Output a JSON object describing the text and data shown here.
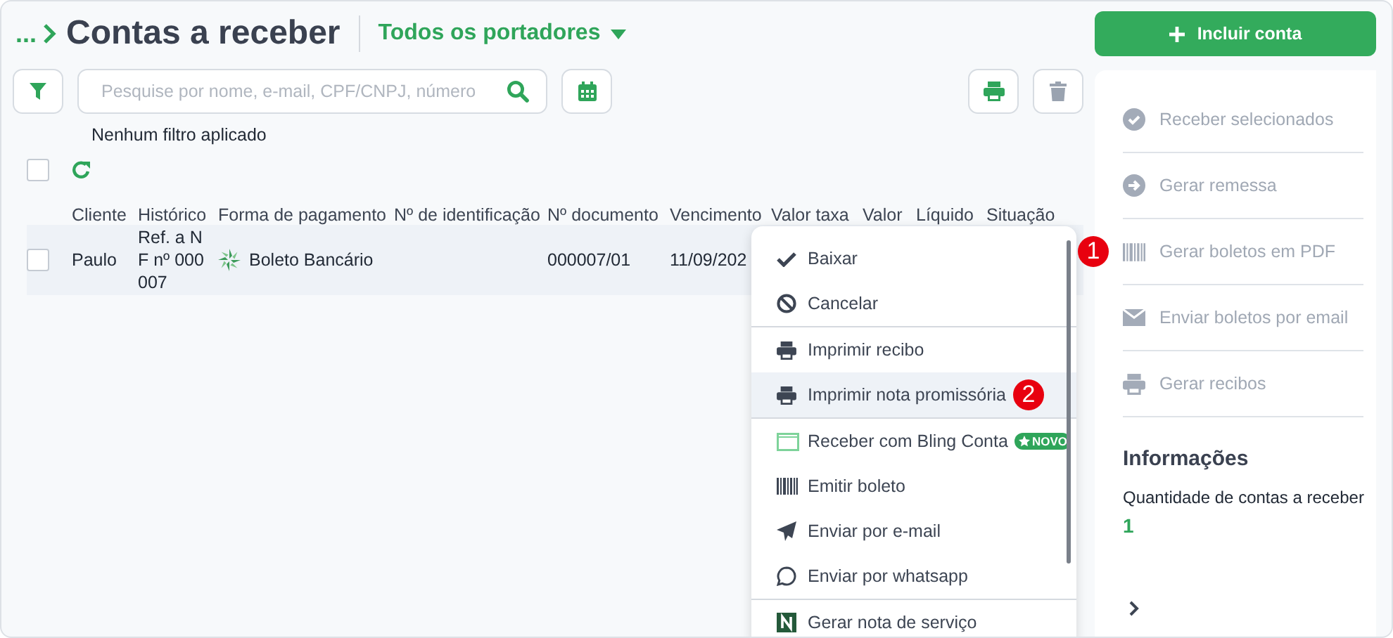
{
  "header": {
    "breadcrumb": "...",
    "title": "Contas a receber",
    "portador": "Todos os portadores"
  },
  "search": {
    "placeholder": "Pesquise por nome, e-mail, CPF/CNPJ, número"
  },
  "filter_status": "Nenhum filtro aplicado",
  "select_all": {
    "checked": false
  },
  "table": {
    "columns": [
      "Cliente",
      "Histórico",
      "Forma de pagamento",
      "Nº de identificação",
      "Nº documento",
      "Vencimento",
      "Valor taxa",
      "Valor",
      "Líquido",
      "Situação"
    ],
    "rows": [
      {
        "checked": false,
        "cliente": "Paulo",
        "historico": "Ref. a N F nº 000 007",
        "forma": "Boleto Bancário",
        "documento": "000007/01",
        "vencimento": "11/09/202"
      }
    ]
  },
  "menu": {
    "items": [
      {
        "label": "Baixar",
        "divider_before": false,
        "highlighted": false
      },
      {
        "label": "Cancelar",
        "divider_before": false,
        "highlighted": false
      },
      {
        "label": "Imprimir recibo",
        "divider_before": true,
        "highlighted": false
      },
      {
        "label": "Imprimir nota promissória",
        "divider_before": false,
        "highlighted": true,
        "marker": "2"
      },
      {
        "label": "Receber com Bling Conta",
        "divider_before": true,
        "highlighted": false,
        "badge": "NOVO"
      },
      {
        "label": "Emitir boleto",
        "divider_before": false,
        "highlighted": false
      },
      {
        "label": "Enviar por e-mail",
        "divider_before": false,
        "highlighted": false
      },
      {
        "label": "Enviar por whatsapp",
        "divider_before": false,
        "highlighted": false
      },
      {
        "label": "Gerar nota de serviço",
        "divider_before": true,
        "highlighted": false
      }
    ]
  },
  "add_button": "Incluir conta",
  "actions": [
    {
      "label": "Receber selecionados",
      "disabled": true
    },
    {
      "label": "Gerar remessa",
      "disabled": true
    },
    {
      "label": "Gerar boletos em PDF",
      "disabled": true,
      "marker": "1"
    },
    {
      "label": "Enviar boletos por email",
      "disabled": true
    },
    {
      "label": "Gerar recibos",
      "disabled": true
    }
  ],
  "info": {
    "title": "Informações",
    "label": "Quantidade de contas a receber",
    "value": "1"
  }
}
